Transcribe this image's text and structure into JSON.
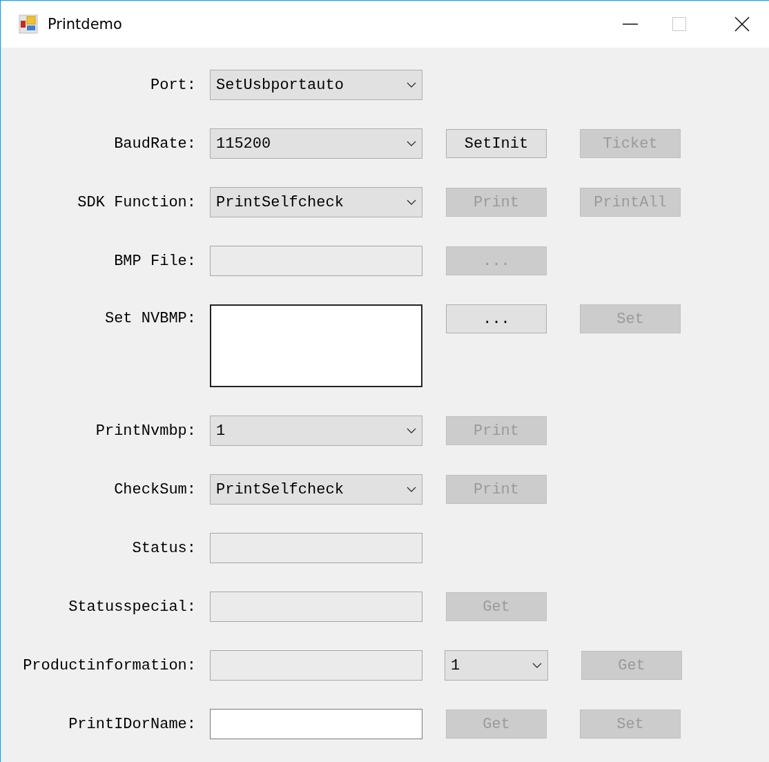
{
  "window": {
    "title": "Printdemo"
  },
  "rows": [
    {
      "label": "Port:",
      "field": {
        "kind": "combo",
        "value": "SetUsbportauto",
        "disabled": false
      },
      "actions": []
    },
    {
      "label": "BaudRate:",
      "field": {
        "kind": "combo",
        "value": "115200",
        "disabled": false
      },
      "actions": [
        {
          "kind": "button",
          "label": "SetInit",
          "disabled": false
        },
        {
          "kind": "button",
          "label": "Ticket",
          "disabled": true
        }
      ]
    },
    {
      "label": "SDK Function:",
      "field": {
        "kind": "combo",
        "value": "PrintSelfcheck",
        "disabled": false
      },
      "actions": [
        {
          "kind": "button",
          "label": "Print",
          "disabled": true
        },
        {
          "kind": "button",
          "label": "PrintAll",
          "disabled": true
        }
      ]
    },
    {
      "label": "BMP File:",
      "field": {
        "kind": "text",
        "disabled": true
      },
      "actions": [
        {
          "kind": "button",
          "label": "...",
          "disabled": true
        }
      ]
    },
    {
      "label": "Set NVBMP:",
      "field": {
        "kind": "textarea",
        "disabled": false
      },
      "actions": [
        {
          "kind": "button",
          "label": "...",
          "disabled": false
        },
        {
          "kind": "button",
          "label": "Set",
          "disabled": true
        }
      ]
    },
    {
      "label": "PrintNvmbp:",
      "field": {
        "kind": "combo",
        "value": "1",
        "disabled": false
      },
      "actions": [
        {
          "kind": "button",
          "label": "Print",
          "disabled": true
        }
      ]
    },
    {
      "label": "CheckSum:",
      "field": {
        "kind": "combo",
        "value": "PrintSelfcheck",
        "disabled": false
      },
      "actions": [
        {
          "kind": "button",
          "label": "Print",
          "disabled": true
        }
      ]
    },
    {
      "label": "Status:",
      "field": {
        "kind": "text",
        "disabled": true
      },
      "actions": []
    },
    {
      "label": "Statusspecial:",
      "field": {
        "kind": "text",
        "disabled": true
      },
      "actions": [
        {
          "kind": "button",
          "label": "Get",
          "disabled": true
        }
      ]
    },
    {
      "label": "Productinformation:",
      "field": {
        "kind": "text",
        "disabled": true
      },
      "actions": [
        {
          "kind": "combo",
          "value": "1",
          "disabled": false
        },
        {
          "kind": "button",
          "label": "Get",
          "disabled": true
        }
      ]
    },
    {
      "label": "PrintIDorName:",
      "field": {
        "kind": "text",
        "disabled": false
      },
      "actions": [
        {
          "kind": "button",
          "label": "Get",
          "disabled": true
        },
        {
          "kind": "button",
          "label": "Set",
          "disabled": true
        }
      ]
    }
  ]
}
